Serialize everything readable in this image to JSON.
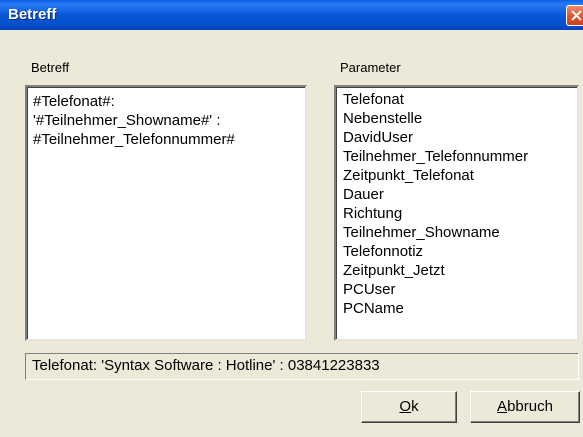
{
  "window": {
    "title": "Betreff"
  },
  "betreff": {
    "label": "Betreff",
    "value": "#Telefonat#:\n'#Teilnehmer_Showname#' :\n#Teilnehmer_Telefonnummer#"
  },
  "parameter": {
    "label": "Parameter",
    "items": [
      "Telefonat",
      "Nebenstelle",
      "DavidUser",
      "Teilnehmer_Telefonnummer",
      "Zeitpunkt_Telefonat",
      "Dauer",
      "Richtung",
      "Teilnehmer_Showname",
      "Telefonnotiz",
      "Zeitpunkt_Jetzt",
      "PCUser",
      "PCName"
    ]
  },
  "preview": {
    "text": "Telefonat: 'Syntax Software : Hotline' : 03841223833"
  },
  "buttons": {
    "ok_accel": "O",
    "ok_rest": "k",
    "cancel_accel": "A",
    "cancel_rest": "bbruch"
  },
  "colors": {
    "titlebar": "#0a58d6",
    "dialog_face": "#ece9d8",
    "close_button": "#e0522e"
  },
  "icons": {
    "close": "close-x-icon"
  }
}
